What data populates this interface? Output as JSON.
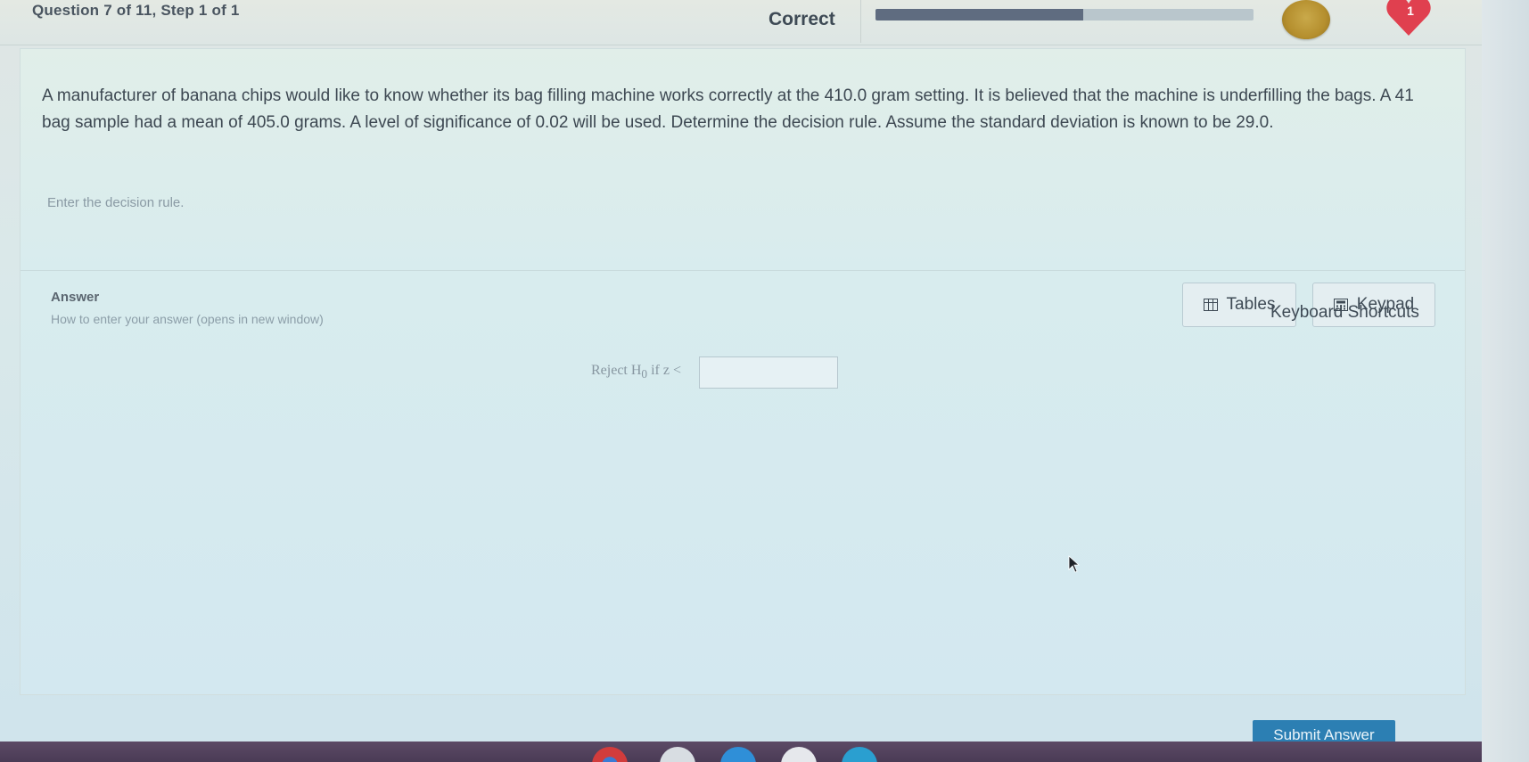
{
  "header": {
    "question_info": "Question 7 of 11, Step 1 of 1",
    "status": "Correct",
    "progress_fraction": 0.55,
    "heart_count": "1"
  },
  "question": {
    "text": "A manufacturer of banana chips would like to know whether its bag filling machine works correctly at the 410.0 gram setting. It is believed that the machine is underfilling the bags. A 41 bag sample had a mean of 405.0 grams. A level of significance of 0.02 will be used. Determine the decision rule. Assume the standard deviation is known to be 29.0.",
    "prompt": "Enter the decision rule."
  },
  "answer": {
    "label": "Answer",
    "help_link": "How to enter your answer (opens in new window)",
    "rule_prefix": "Reject H",
    "rule_subscript": "0",
    "rule_suffix": " if z <",
    "input_value": ""
  },
  "tools": {
    "tables_label": "Tables",
    "keypad_label": "Keypad",
    "shortcuts_label": "Keyboard Shortcuts"
  },
  "footer": {
    "submit_label": "Submit Answer"
  },
  "colors": {
    "accent": "#2c7fb3",
    "heart": "#e0404f",
    "progress": "#5f6c80"
  }
}
